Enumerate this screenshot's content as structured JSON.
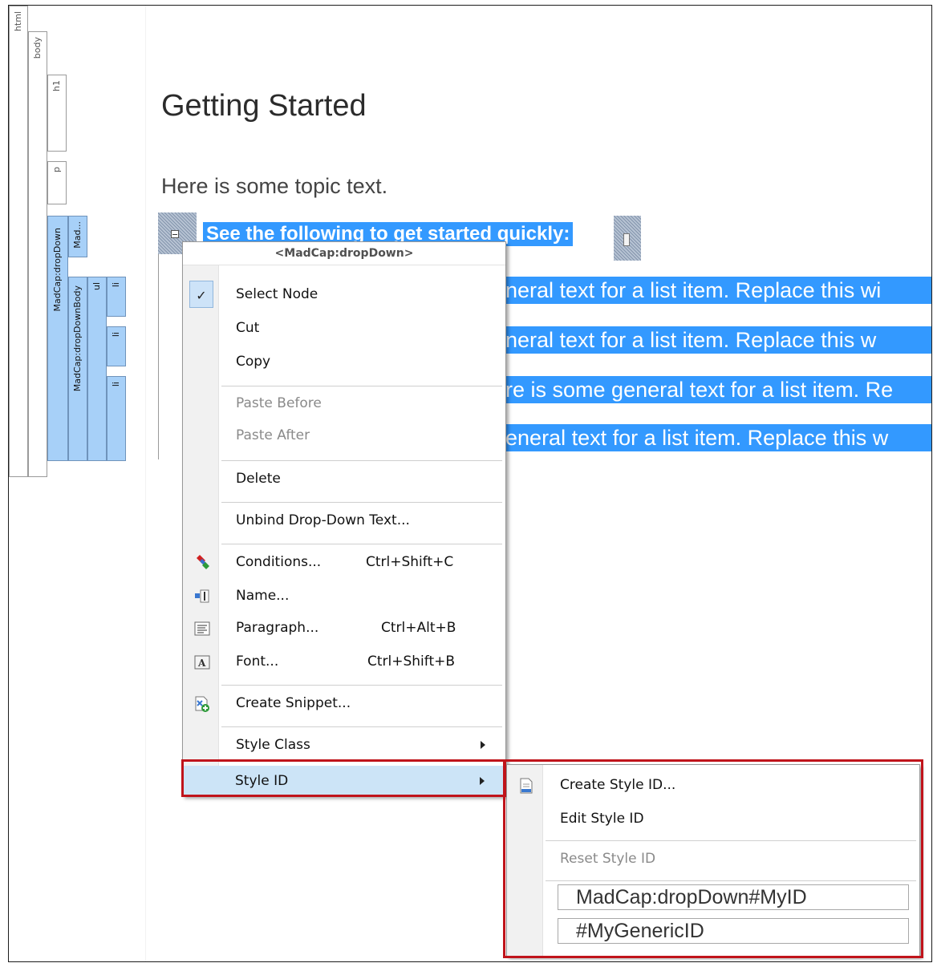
{
  "structure_bar": {
    "html": "html",
    "body": "body",
    "h1": "h1",
    "p": "p",
    "dropdown": "MadCap:dropDown",
    "dropdown_head": "Mad...",
    "dropdown_body": "MadCap:dropDownBody",
    "ul": "ul",
    "li1": "li",
    "li2": "li",
    "li3": "li"
  },
  "editor": {
    "heading": "Getting Started",
    "paragraph": "Here is some topic text.",
    "hotspot": "See the following to get started quickly:",
    "list_items": [
      "eneral text for a list item. Replace this wi",
      "eneral text for a list item. Replace this w",
      "ere is some general text for a list item. Re",
      " general text for a list item. Replace this w"
    ]
  },
  "context_menu": {
    "header": "<MadCap:dropDown>",
    "select_node": "Select Node",
    "cut": "Cut",
    "copy": "Copy",
    "paste_before": "Paste Before",
    "paste_after": "Paste After",
    "delete": "Delete",
    "unbind": "Unbind Drop-Down Text...",
    "conditions": "Conditions...",
    "conditions_shortcut": "Ctrl+Shift+C",
    "name": "Name...",
    "paragraph": "Paragraph...",
    "paragraph_shortcut": "Ctrl+Alt+B",
    "font": "Font...",
    "font_shortcut": "Ctrl+Shift+B",
    "create_snippet": "Create Snippet...",
    "style_class": "Style Class",
    "style_id": "Style ID"
  },
  "submenu": {
    "create_style_id": "Create Style ID...",
    "edit_style_id": "Edit Style ID",
    "reset_style_id": "Reset Style ID",
    "id_option_1": "MadCap:dropDown#MyID",
    "id_option_2": "#MyGenericID"
  },
  "colors": {
    "selection": "#3399ff",
    "highlight_box": "#c0141b",
    "menu_hover": "#cce4f7"
  }
}
